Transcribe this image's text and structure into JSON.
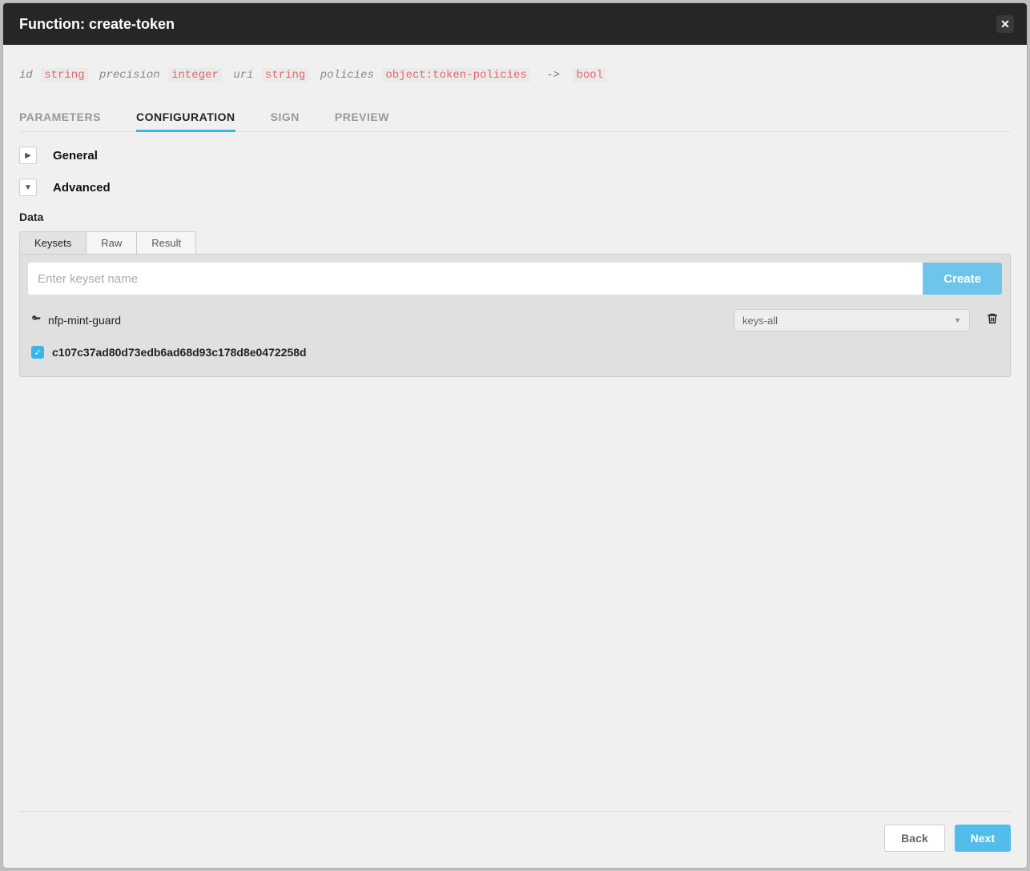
{
  "modal": {
    "title": "Function: create-token"
  },
  "signature": {
    "params": [
      {
        "name": "id",
        "type": "string"
      },
      {
        "name": "precision",
        "type": "integer"
      },
      {
        "name": "uri",
        "type": "string"
      },
      {
        "name": "policies",
        "type": "object:token-policies"
      }
    ],
    "arrow": "->",
    "returnType": "bool"
  },
  "mainTabs": {
    "items": [
      "PARAMETERS",
      "CONFIGURATION",
      "SIGN",
      "PREVIEW"
    ],
    "active": "CONFIGURATION"
  },
  "sections": {
    "general": {
      "label": "General",
      "expanded": false
    },
    "advanced": {
      "label": "Advanced",
      "expanded": true
    }
  },
  "dataSection": {
    "label": "Data",
    "subtabs": [
      "Keysets",
      "Raw",
      "Result"
    ],
    "activeSubtab": "Keysets",
    "keysetInput": {
      "placeholder": "Enter keyset name",
      "value": ""
    },
    "createButton": "Create",
    "keyset": {
      "name": "nfp-mint-guard",
      "predicate": "keys-all",
      "keys": [
        {
          "hash": "c107c37ad80d73edb6ad68d93c178d8e0472258d",
          "checked": true
        }
      ]
    }
  },
  "footer": {
    "back": "Back",
    "next": "Next"
  }
}
